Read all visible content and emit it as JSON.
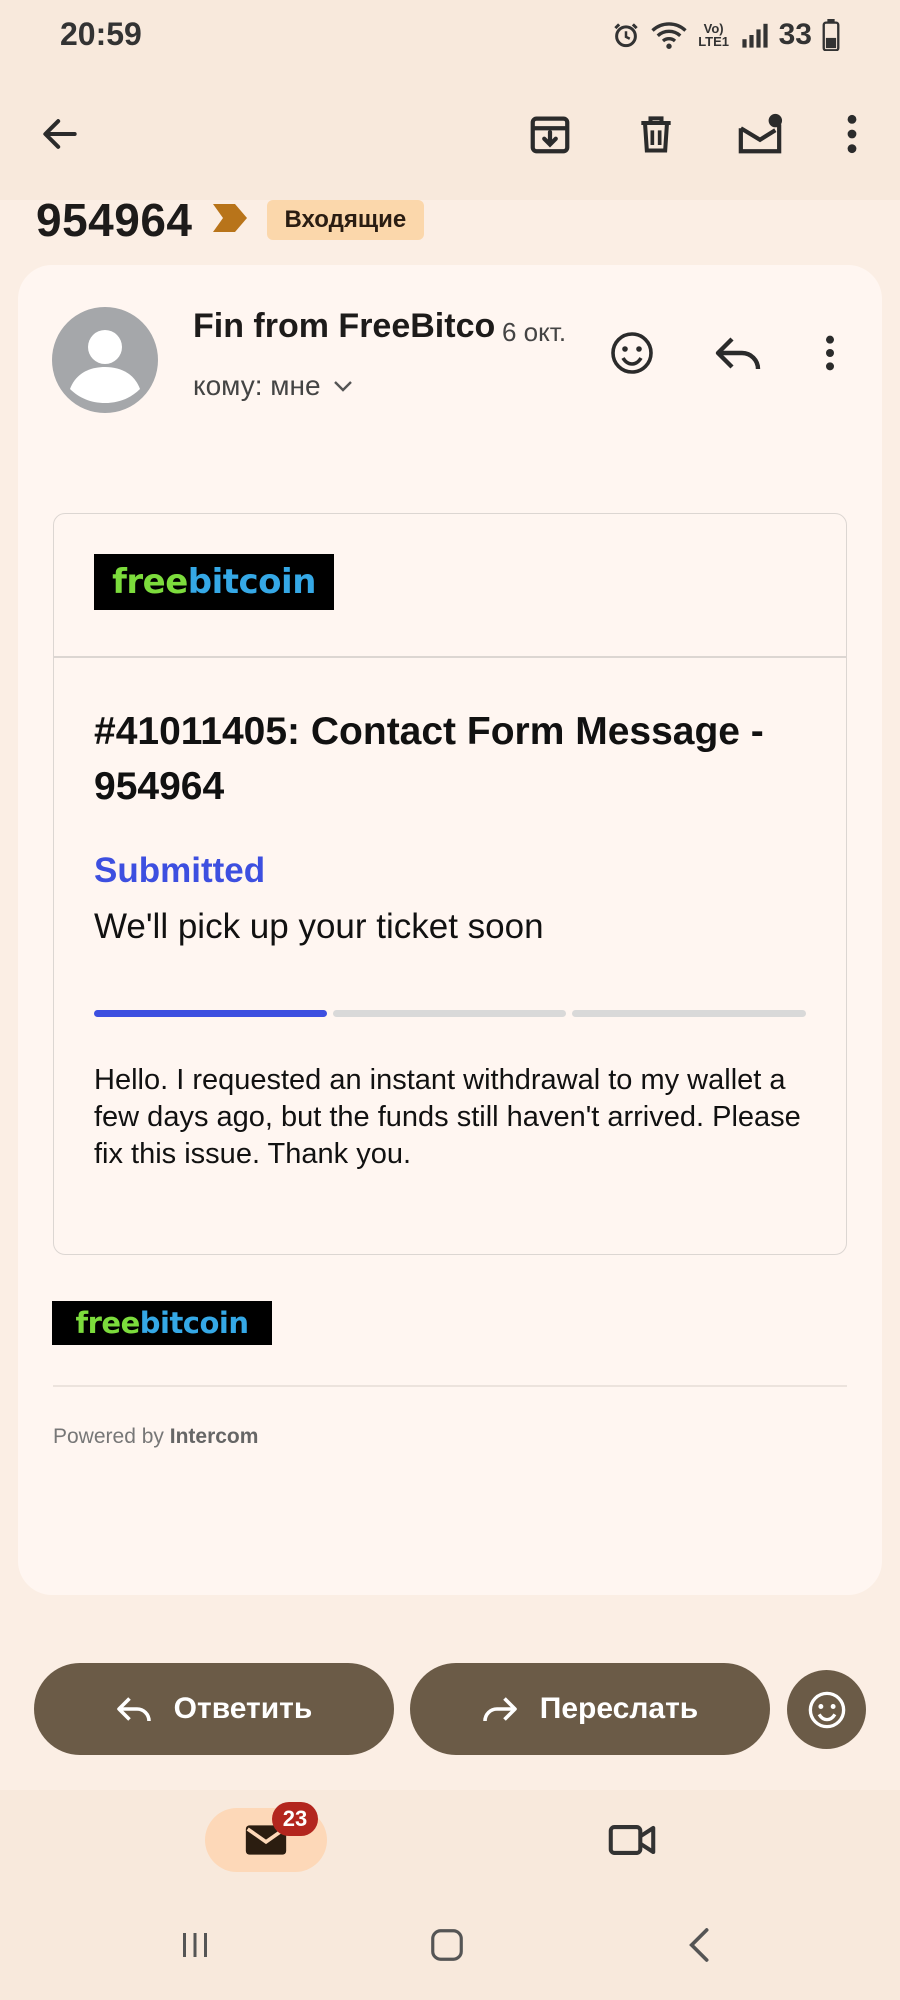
{
  "status_bar": {
    "time": "20:59",
    "signal_label": "Vo) LTE1",
    "battery": "33",
    "icons": [
      "alarm-icon",
      "wifi-icon",
      "signal-icon",
      "battery-icon"
    ]
  },
  "toolbar": {
    "icons": [
      "back-arrow-icon",
      "archive-icon",
      "delete-icon",
      "mark-unread-icon",
      "more-vert-icon"
    ]
  },
  "subject": {
    "text": "954964",
    "label": "Входящие",
    "label_color": "#fbd7ab",
    "importance_color": "#b8741a"
  },
  "email": {
    "sender": "Fin from FreeBitco",
    "date": "6 окт.",
    "recipient": "кому: мне",
    "message": {
      "logo_free": "free",
      "logo_bitcoin": "bitcoin",
      "ticket_title": "#41011405: Contact Form Message - 954964",
      "status": "Submitted",
      "status_subtitle": "We'll pick up your ticket soon",
      "progress": {
        "steps_total": 3,
        "steps_completed": 1,
        "active_color": "#3d4fe0",
        "inactive_color": "#d9d9d9"
      },
      "body": "Hello. I requested an instant withdrawal to my wallet a few days ago, but the funds still haven't arrived. Please fix this issue. Thank you."
    },
    "footer": {
      "logo_free": "free",
      "logo_bitcoin": "bitcoin",
      "powered_by_prefix": "Powered by",
      "powered_by_brand": "Intercom"
    }
  },
  "actions": {
    "reply": "Ответить",
    "forward": "Переслать"
  },
  "bottom_nav": {
    "mail_badge": "23"
  },
  "colors": {
    "background": "#fbeee4",
    "card": "#fff6f1",
    "action_button": "#6b5b47",
    "badge": "#b3261e"
  }
}
